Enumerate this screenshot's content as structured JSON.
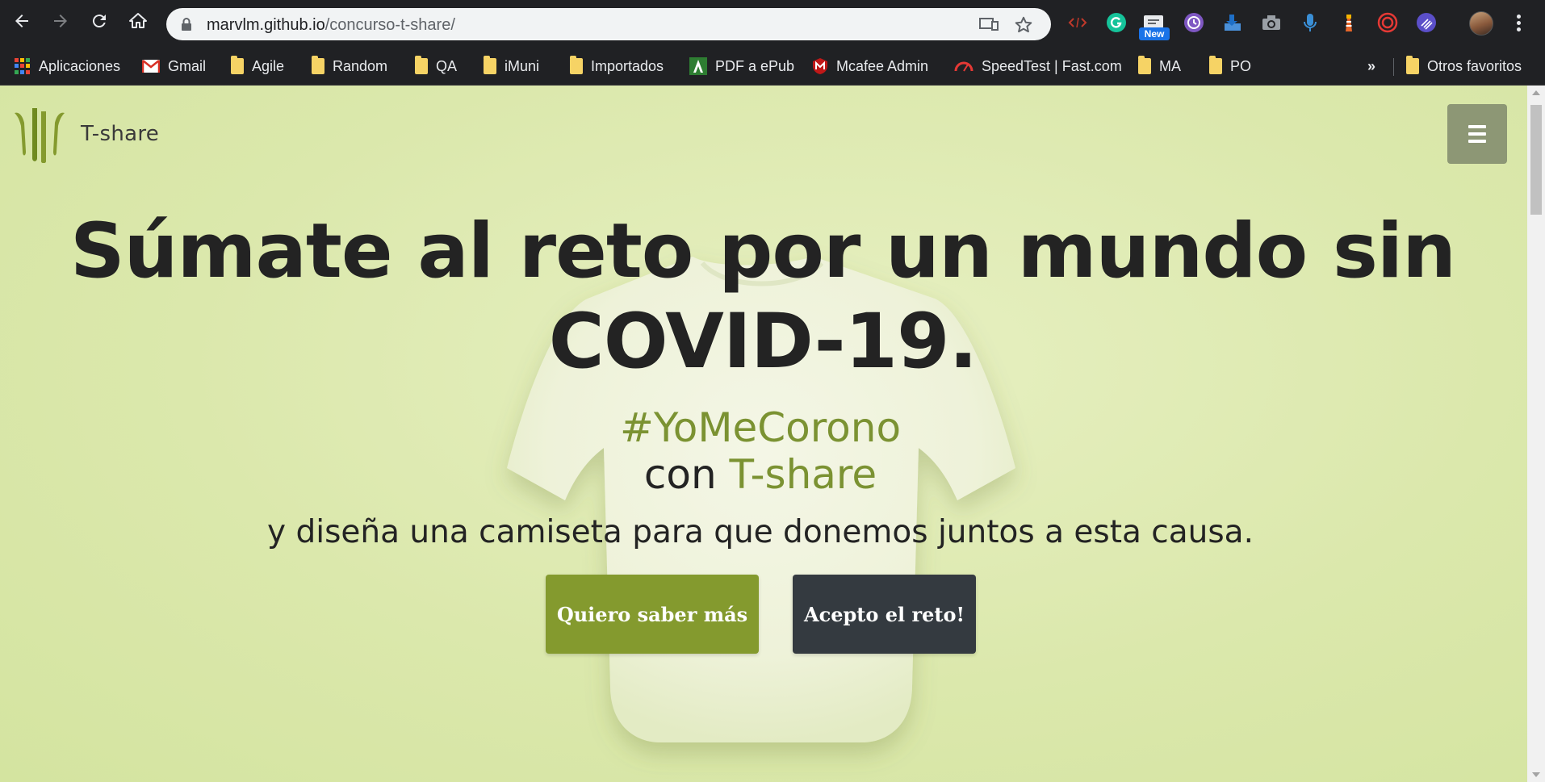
{
  "browser": {
    "url_host": "marvlm.github.io",
    "url_path": "/concurso-t-share/",
    "extension_badge": "New"
  },
  "bookmarks": [
    {
      "label": "Aplicaciones",
      "icon": "apps-grid-icon"
    },
    {
      "label": "Gmail",
      "icon": "gmail-icon"
    },
    {
      "label": "Agile",
      "icon": "folder-icon"
    },
    {
      "label": "Random",
      "icon": "folder-icon"
    },
    {
      "label": "QA",
      "icon": "folder-icon"
    },
    {
      "label": "iMuni",
      "icon": "folder-icon"
    },
    {
      "label": "Importados",
      "icon": "folder-icon"
    },
    {
      "label": "PDF a ePub",
      "icon": "pdf-epub-icon"
    },
    {
      "label": "Mcafee Admin",
      "icon": "mcafee-icon"
    },
    {
      "label": "SpeedTest | Fast.com",
      "icon": "speedtest-icon"
    },
    {
      "label": "MA",
      "icon": "folder-icon"
    },
    {
      "label": "PO",
      "icon": "folder-icon"
    }
  ],
  "bookmarks_overflow": "»",
  "other_bookmarks": "Otros favoritos",
  "site": {
    "brand": "T-share",
    "headline_line1": "Súmate al reto por un mundo sin",
    "headline_line2": "COVID-19.",
    "hashtag": "#YoMeCorono",
    "con_prefix": "con ",
    "con_brand": "T-share",
    "subline": "y diseña una camiseta para que donemos juntos a esta causa.",
    "cta_primary": "Quiero saber más",
    "cta_secondary": "Acepto el reto!"
  },
  "colors": {
    "page_bg": "#dbe8ac",
    "accent_green": "#849a2e",
    "dark_button": "#343a40",
    "menu_button": "#8d9775"
  }
}
